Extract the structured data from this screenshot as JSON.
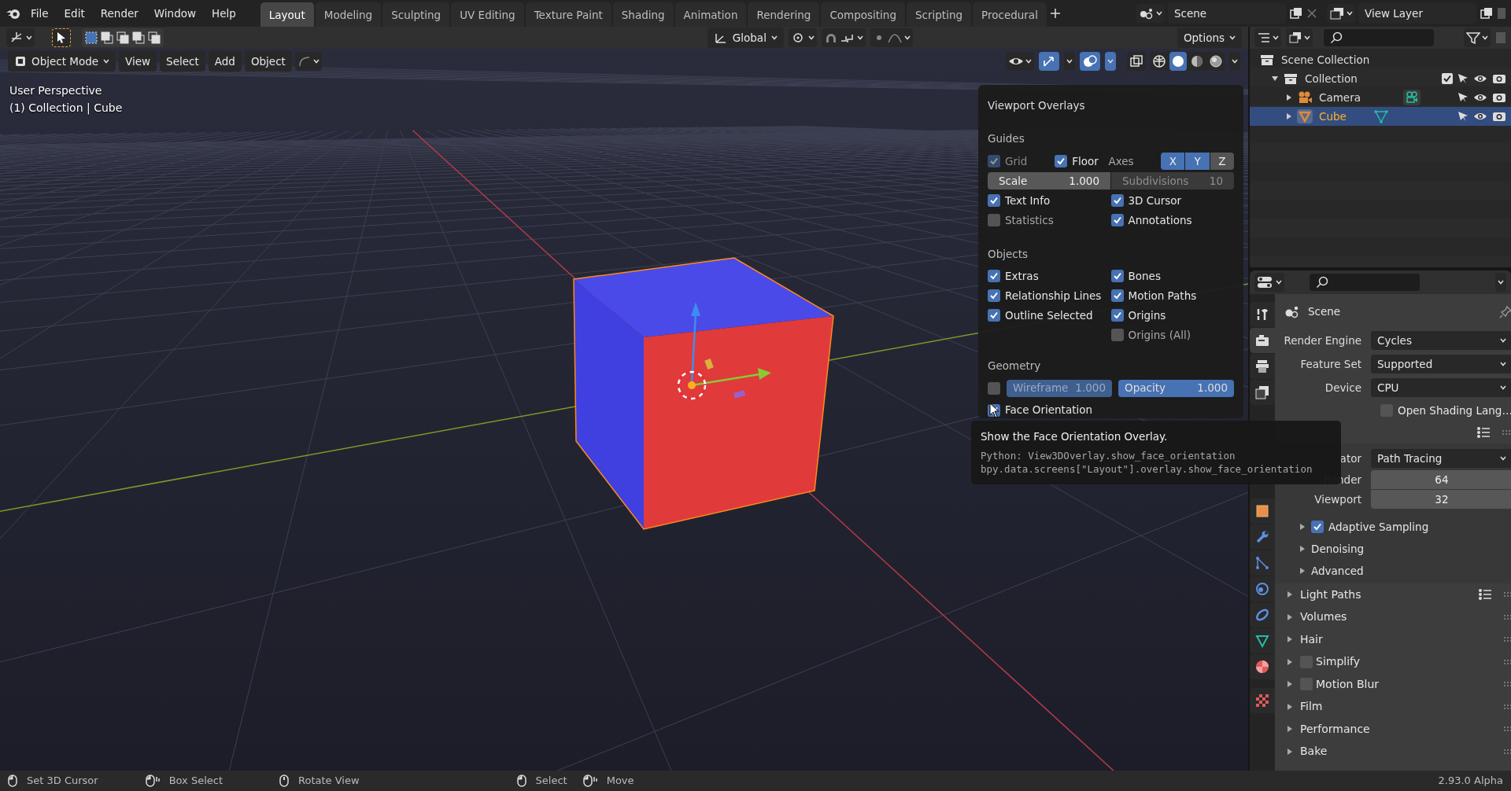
{
  "menu": [
    "File",
    "Edit",
    "Render",
    "Window",
    "Help"
  ],
  "workspaces": [
    {
      "label": "Layout",
      "selected": true
    },
    {
      "label": "Modeling",
      "selected": false
    },
    {
      "label": "Sculpting",
      "selected": false
    },
    {
      "label": "UV Editing",
      "selected": false
    },
    {
      "label": "Texture Paint",
      "selected": false
    },
    {
      "label": "Shading",
      "selected": false
    },
    {
      "label": "Animation",
      "selected": false
    },
    {
      "label": "Rendering",
      "selected": false
    },
    {
      "label": "Compositing",
      "selected": false
    },
    {
      "label": "Scripting",
      "selected": false
    },
    {
      "label": "Procedural",
      "selected": false
    }
  ],
  "scene": "Scene",
  "view_layer": "View Layer",
  "toolbar": {
    "orientation": "Global",
    "options": "Options"
  },
  "viewport": {
    "mode": "Object Mode",
    "menus": [
      "View",
      "Select",
      "Add",
      "Object"
    ],
    "info": [
      "User Perspective",
      "(1) Collection | Cube"
    ],
    "shading": [
      {
        "kind": "wireframe",
        "selected": false
      },
      {
        "kind": "solid",
        "selected": true
      },
      {
        "kind": "material",
        "selected": false
      },
      {
        "kind": "rendered",
        "selected": false
      }
    ]
  },
  "overlays": {
    "title": "Viewport Overlays",
    "guides": {
      "heading": "Guides",
      "grid": {
        "label": "Grid",
        "checked": true,
        "disabled": true
      },
      "floor": {
        "label": "Floor",
        "checked": true,
        "disabled": false
      },
      "axes": {
        "label": "Axes",
        "buttons": [
          {
            "label": "X",
            "selected": true
          },
          {
            "label": "Y",
            "selected": true
          },
          {
            "label": "Z",
            "selected": false
          }
        ]
      },
      "scale": {
        "label": "Scale",
        "value": "1.000",
        "disabled": false
      },
      "subdivisions": {
        "label": "Subdivisions",
        "value": "10",
        "disabled": true
      },
      "left": [
        {
          "label": "Text Info",
          "checked": true
        },
        {
          "label": "Statistics",
          "checked": false
        }
      ],
      "right": [
        {
          "label": "3D Cursor",
          "checked": true
        },
        {
          "label": "Annotations",
          "checked": true
        }
      ]
    },
    "objects": {
      "heading": "Objects",
      "left": [
        {
          "label": "Extras",
          "checked": true
        },
        {
          "label": "Relationship Lines",
          "checked": true
        },
        {
          "label": "Outline Selected",
          "checked": true
        }
      ],
      "right": [
        {
          "label": "Bones",
          "checked": true
        },
        {
          "label": "Motion Paths",
          "checked": true
        },
        {
          "label": "Origins",
          "checked": true
        },
        {
          "label": "Origins (All)",
          "checked": false
        }
      ]
    },
    "geometry": {
      "heading": "Geometry",
      "wireframe_toggle": {
        "checked": false
      },
      "wireframe": {
        "label": "Wireframe",
        "value": "1.000",
        "disabled": true
      },
      "opacity": {
        "label": "Opacity",
        "value": "1.000",
        "disabled": false
      },
      "face_orientation": {
        "label": "Face Orientation",
        "checked": true
      }
    }
  },
  "tooltip": {
    "title": "Show the Face Orientation Overlay.",
    "lines": [
      "Python: View3DOverlay.show_face_orientation",
      "bpy.data.screens[\"Layout\"].overlay.show_face_orientation"
    ]
  },
  "outliner": {
    "tree": [
      {
        "label": "Scene Collection",
        "kind": "scene_collection",
        "selected": false,
        "children": [
          {
            "label": "Collection",
            "kind": "collection",
            "selected": false,
            "expanded": true,
            "checked": true,
            "children": [
              {
                "label": "Camera",
                "kind": "camera",
                "selected": false,
                "expanded": false
              },
              {
                "label": "Cube",
                "kind": "mesh",
                "selected": true,
                "expanded": false
              }
            ]
          }
        ]
      }
    ]
  },
  "properties": {
    "tabs_top": [
      {
        "kind": "tool",
        "selected": false
      },
      {
        "kind": "render",
        "selected": true
      },
      {
        "kind": "output",
        "selected": false
      },
      {
        "kind": "view_layer",
        "selected": false
      }
    ],
    "tabs_bottom": [
      {
        "kind": "object",
        "selected": false
      },
      {
        "kind": "modifiers",
        "selected": false
      },
      {
        "kind": "particles",
        "selected": false
      },
      {
        "kind": "physics",
        "selected": false
      },
      {
        "kind": "constraints",
        "selected": false
      },
      {
        "kind": "data",
        "selected": false
      },
      {
        "kind": "material",
        "selected": false
      },
      {
        "kind": "texture",
        "selected": false
      }
    ],
    "context": "Scene",
    "fields": [
      {
        "label": "Render Engine",
        "value": "Cycles"
      },
      {
        "label": "Feature Set",
        "value": "Supported"
      },
      {
        "label": "Device",
        "value": "CPU"
      }
    ],
    "osl": {
      "label": "Open Shading Lang…",
      "checked": false
    },
    "sampling": {
      "integrator": {
        "label": "ator",
        "value": "Path Tracing"
      },
      "samples": [
        {
          "label": "Render",
          "value": "64"
        },
        {
          "label": "Viewport",
          "value": "32"
        }
      ],
      "subpanels": [
        {
          "kind": "toggle",
          "label": "Adaptive Sampling",
          "checked": true
        },
        {
          "kind": "plain",
          "label": "Denoising"
        },
        {
          "kind": "plain",
          "label": "Advanced"
        }
      ]
    },
    "panels": [
      {
        "kind": "presets",
        "label": "Light Paths"
      },
      {
        "kind": "plain",
        "label": "Volumes"
      },
      {
        "kind": "plain",
        "label": "Hair"
      },
      {
        "kind": "toggle",
        "label": "Simplify",
        "checked": false
      },
      {
        "kind": "toggle",
        "label": "Motion Blur",
        "checked": false
      },
      {
        "kind": "plain",
        "label": "Film"
      },
      {
        "kind": "plain",
        "label": "Performance"
      },
      {
        "kind": "plain",
        "label": "Bake"
      }
    ]
  },
  "status_bar": {
    "hints": [
      {
        "kind": "left",
        "label": "Set 3D Cursor"
      },
      {
        "kind": "drag",
        "label": "Box Select"
      },
      {
        "kind": "middle",
        "label": "Rotate View"
      },
      {
        "kind": "left",
        "label": "Select"
      },
      {
        "kind": "drag",
        "label": "Move"
      }
    ],
    "version": "2.93.0 Alpha"
  }
}
